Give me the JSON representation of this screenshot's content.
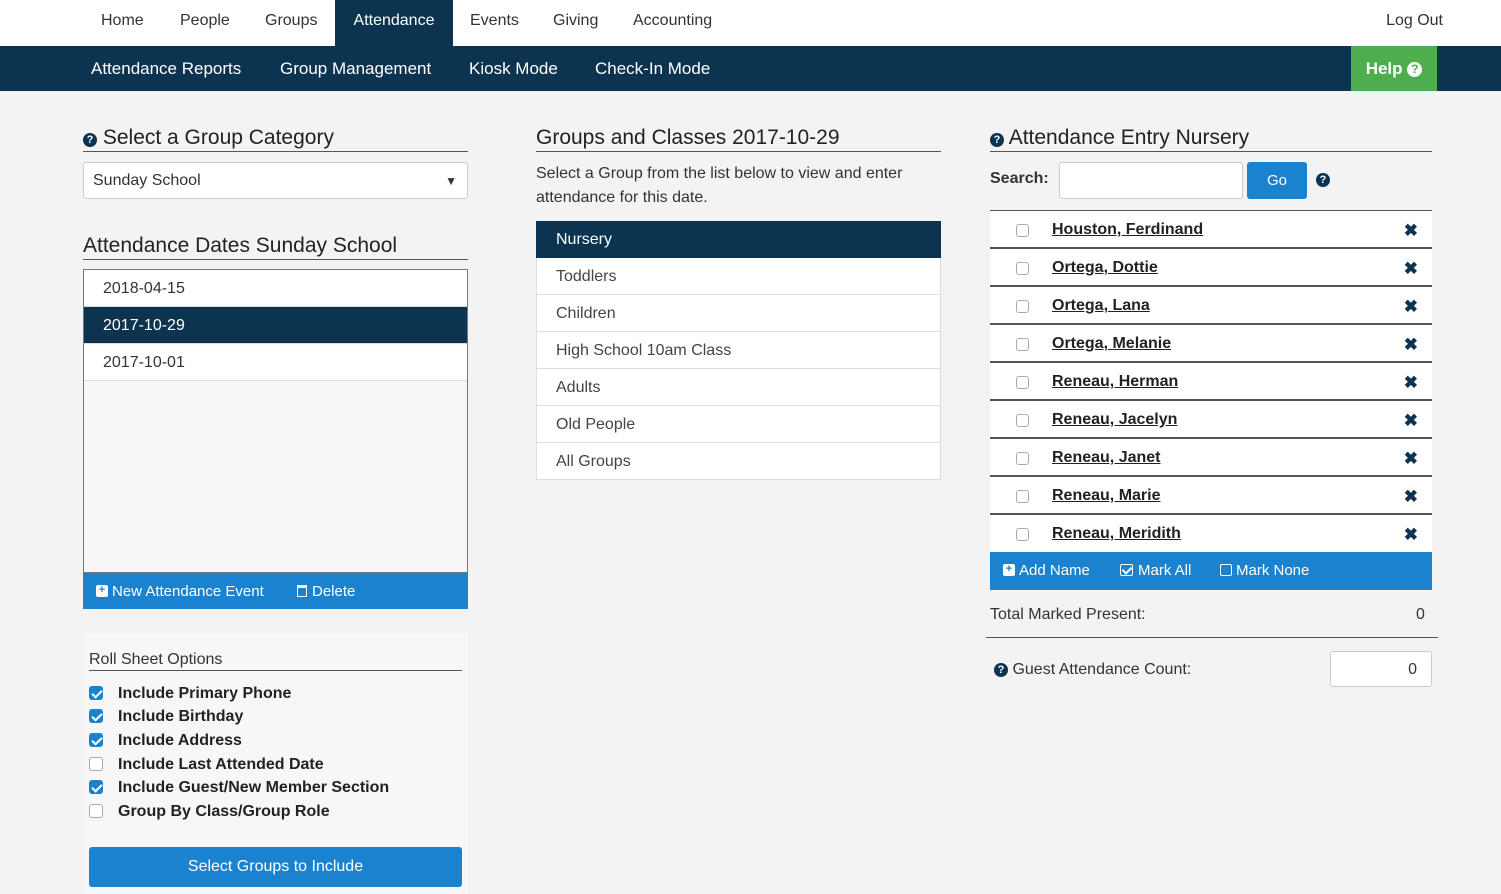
{
  "topnav": {
    "items": [
      "Home",
      "People",
      "Groups",
      "Attendance",
      "Events",
      "Giving",
      "Accounting"
    ],
    "active": "Attendance",
    "logout": "Log Out"
  },
  "subnav": {
    "items": [
      "Attendance Reports",
      "Group Management",
      "Kiosk Mode",
      "Check-In Mode"
    ],
    "help": "Help"
  },
  "left": {
    "category_title": "Select a Group Category",
    "category_value": "Sunday School",
    "dates_title": "Attendance Dates Sunday School",
    "dates": [
      "2018-04-15",
      "2017-10-29",
      "2017-10-01"
    ],
    "selected_date": "2017-10-29",
    "new_event": "New Attendance Event",
    "delete": "Delete",
    "roll_title": "Roll Sheet Options",
    "options": [
      {
        "label": "Include Primary Phone",
        "checked": true
      },
      {
        "label": "Include Birthday",
        "checked": true
      },
      {
        "label": "Include Address",
        "checked": true
      },
      {
        "label": "Include Last Attended Date",
        "checked": false
      },
      {
        "label": "Include Guest/New Member Section",
        "checked": true
      },
      {
        "label": "Group By Class/Group Role",
        "checked": false
      }
    ],
    "select_groups": "Select Groups to Include"
  },
  "middle": {
    "title": "Groups and Classes 2017-10-29",
    "description": "Select a Group from the list below to view and enter attendance for this date.",
    "groups": [
      "Nursery",
      "Toddlers",
      "Children",
      "High School 10am Class",
      "Adults",
      "Old People",
      "All Groups"
    ],
    "selected": "Nursery"
  },
  "right": {
    "title": "Attendance Entry Nursery",
    "search_label": "Search:",
    "search_value": "",
    "go": "Go",
    "people": [
      "Houston, Ferdinand",
      "Ortega, Dottie",
      "Ortega, Lana",
      "Ortega, Melanie",
      "Reneau, Herman",
      "Reneau, Jacelyn",
      "Reneau, Janet",
      "Reneau, Marie",
      "Reneau, Meridith"
    ],
    "remove_glyph": "✖",
    "add_name": "Add Name",
    "mark_all": "Mark All",
    "mark_none": "Mark None",
    "total_label": "Total Marked Present:",
    "total_value": "0",
    "guest_label": "Guest Attendance Count:",
    "guest_value": "0"
  },
  "colors": {
    "navy": "#0c3350",
    "blue": "#1a82cf",
    "green": "#4cae4c"
  }
}
